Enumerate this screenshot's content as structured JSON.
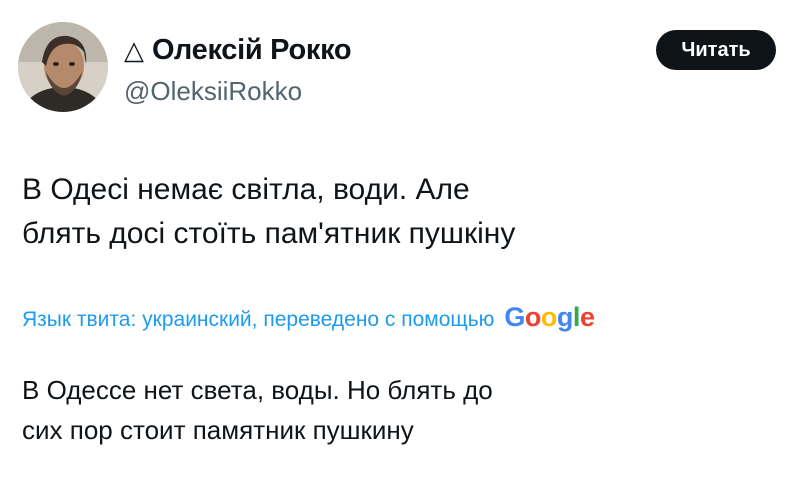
{
  "author": {
    "name_icon": "triangle-outline-icon",
    "name_glyph": "△",
    "name": "Олексій Рокко",
    "handle": "@OleksiiRokko",
    "avatar_icon": "profile-photo"
  },
  "follow_button": {
    "label": "Читать"
  },
  "tweet": {
    "line1": "В Одесі немає світла, води. Але",
    "line2": "блять досі стоїть пам'ятник пушкіну"
  },
  "translation": {
    "label": "Язык твита: украинский, переведено с помощью",
    "provider": [
      "G",
      "o",
      "o",
      "g",
      "l",
      "e"
    ],
    "line1": "В Одессе нет света, воды. Но блять до",
    "line2": "сих пор стоит памятник пушкину"
  },
  "colors": {
    "accent": "#1d9bf0",
    "text": "#0f1419",
    "secondary": "#536471",
    "button_bg": "#0f1419"
  }
}
